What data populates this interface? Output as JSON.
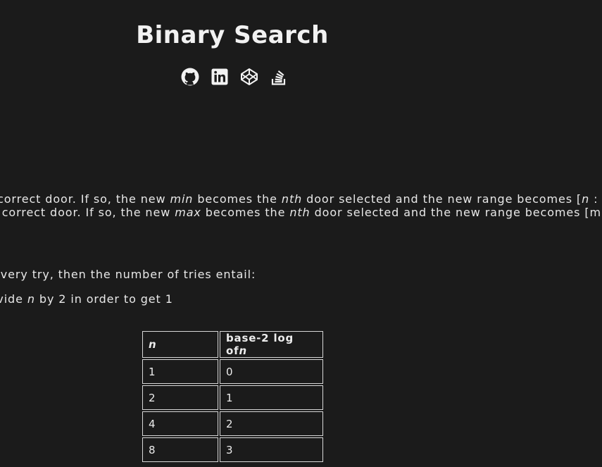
{
  "page": {
    "title": "Binary Search"
  },
  "socials": [
    {
      "name": "github-icon",
      "label": "GitHub"
    },
    {
      "name": "linkedin-icon",
      "label": "LinkedIn"
    },
    {
      "name": "codepen-icon",
      "label": "CodePen"
    },
    {
      "name": "stackoverflow-icon",
      "label": "Stack Overflow"
    }
  ],
  "content": {
    "line1": {
      "a": "correct door. If so, the new ",
      "b": "min",
      "c": " becomes the ",
      "d": "nth",
      "e": " door selected and the new range becomes [",
      "f": "n",
      "g": " : m"
    },
    "line2": {
      "a": "e correct door. If so, the new ",
      "b": "max",
      "c": " becomes the ",
      "d": "nth",
      "e": " door selected and the new range becomes [min"
    },
    "line3": "every try, then the number of tries entail:",
    "line4": {
      "a": "ivide ",
      "b": "n",
      "c": " by 2 in order to get 1"
    }
  },
  "table": {
    "headers": {
      "n": "n",
      "log_prefix": "base-2 log of",
      "log_var": "n"
    },
    "rows": [
      {
        "n": "1",
        "log": "0"
      },
      {
        "n": "2",
        "log": "1"
      },
      {
        "n": "4",
        "log": "2"
      },
      {
        "n": "8",
        "log": "3"
      }
    ]
  }
}
